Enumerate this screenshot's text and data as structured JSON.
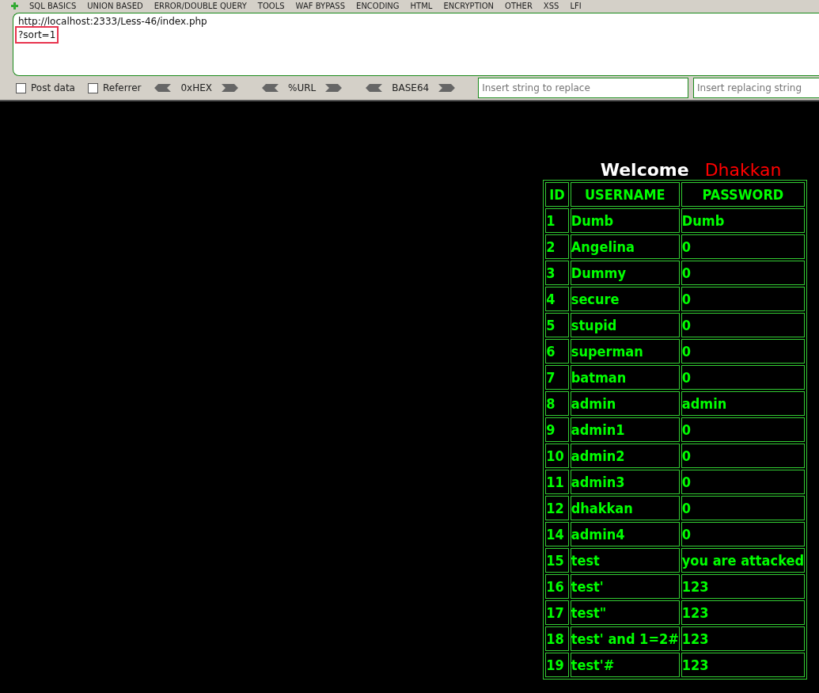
{
  "menu": [
    "SQL BASICS",
    "UNION BASED",
    "ERROR/DOUBLE QUERY",
    "TOOLS",
    "WAF BYPASS",
    "ENCODING",
    "HTML",
    "ENCRYPTION",
    "OTHER",
    "XSS",
    "LFI"
  ],
  "url": {
    "line1": "http://localhost:2333/Less-46/index.php",
    "line2": "?sort=1"
  },
  "toolbar": {
    "post_data": {
      "label": "Post data",
      "checked": false
    },
    "referrer": {
      "label": "Referrer",
      "checked": false
    },
    "encoders": [
      "0xHEX",
      "%URL",
      "BASE64"
    ],
    "replace_field": {
      "placeholder": "Insert string to replace"
    },
    "replacing_field": {
      "placeholder": "Insert replacing string"
    }
  },
  "welcome": {
    "greeting": "Welcome",
    "name": "Dhakkan"
  },
  "table": {
    "columns": [
      "ID",
      "USERNAME",
      "PASSWORD"
    ],
    "rows": [
      [
        "1",
        "Dumb",
        "Dumb"
      ],
      [
        "2",
        "Angelina",
        "0"
      ],
      [
        "3",
        "Dummy",
        "0"
      ],
      [
        "4",
        "secure",
        "0"
      ],
      [
        "5",
        "stupid",
        "0"
      ],
      [
        "6",
        "superman",
        "0"
      ],
      [
        "7",
        "batman",
        "0"
      ],
      [
        "8",
        "admin",
        "admin"
      ],
      [
        "9",
        "admin1",
        "0"
      ],
      [
        "10",
        "admin2",
        "0"
      ],
      [
        "11",
        "admin3",
        "0"
      ],
      [
        "12",
        "dhakkan",
        "0"
      ],
      [
        "14",
        "admin4",
        "0"
      ],
      [
        "15",
        "test",
        "you are attacked"
      ],
      [
        "16",
        "test'",
        "123"
      ],
      [
        "17",
        "test\"",
        "123"
      ],
      [
        "18",
        "test' and 1=2#",
        "123"
      ],
      [
        "19",
        "test'#",
        "123"
      ]
    ]
  }
}
